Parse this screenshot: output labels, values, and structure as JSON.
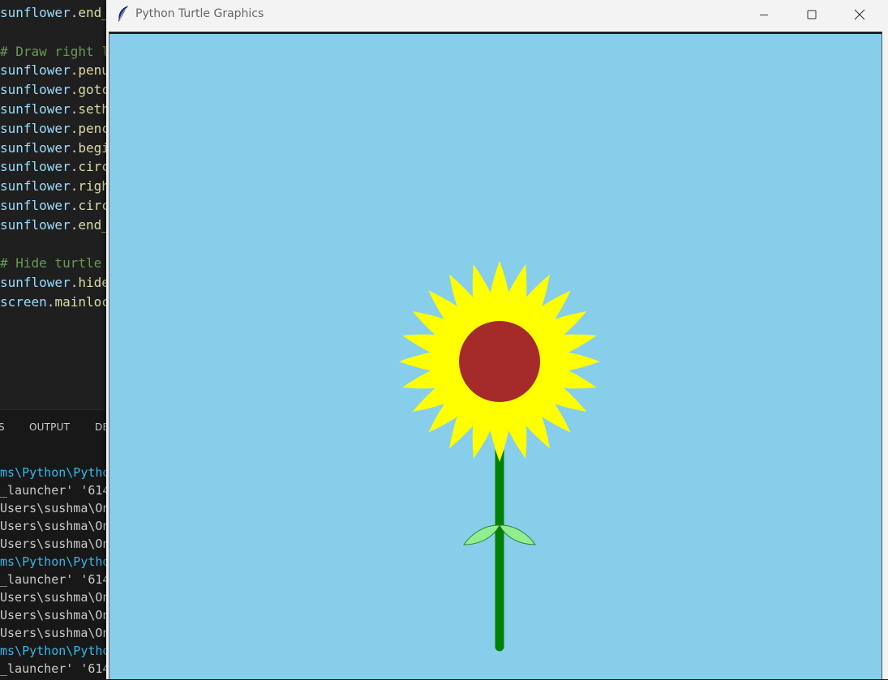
{
  "editor": {
    "lines": [
      {
        "kind": "code",
        "obj": "sunflower",
        "method": "end_"
      },
      {
        "kind": "blank"
      },
      {
        "kind": "comment",
        "text": "# Draw right l"
      },
      {
        "kind": "code",
        "obj": "sunflower",
        "method": "penu"
      },
      {
        "kind": "code",
        "obj": "sunflower",
        "method": "gotc"
      },
      {
        "kind": "code",
        "obj": "sunflower",
        "method": "seth"
      },
      {
        "kind": "code",
        "obj": "sunflower",
        "method": "penc"
      },
      {
        "kind": "code",
        "obj": "sunflower",
        "method": "begi"
      },
      {
        "kind": "code",
        "obj": "sunflower",
        "method": "circ"
      },
      {
        "kind": "code",
        "obj": "sunflower",
        "method": "righ"
      },
      {
        "kind": "code",
        "obj": "sunflower",
        "method": "circ"
      },
      {
        "kind": "code",
        "obj": "sunflower",
        "method": "end_"
      },
      {
        "kind": "blank"
      },
      {
        "kind": "comment",
        "text": "# Hide turtle"
      },
      {
        "kind": "code",
        "obj": "sunflower",
        "method": "hide"
      },
      {
        "kind": "code",
        "obj": "screen",
        "method": "mainloc"
      }
    ]
  },
  "panel": {
    "tabs": [
      "S",
      "OUTPUT",
      "DE"
    ],
    "terminal_lines": [
      {
        "kind": "path",
        "text": "ms\\Python\\Pythor"
      },
      {
        "kind": "plain",
        "text": "_launcher' '614"
      },
      {
        "kind": "plain",
        "text": "Users\\sushma\\One"
      },
      {
        "kind": "plain",
        "text": "Users\\sushma\\One"
      },
      {
        "kind": "plain",
        "text": "Users\\sushma\\One"
      },
      {
        "kind": "path",
        "text": "ms\\Python\\Pythor"
      },
      {
        "kind": "plain",
        "text": "_launcher' '614("
      },
      {
        "kind": "plain",
        "text": "Users\\sushma\\One"
      },
      {
        "kind": "plain",
        "text": "Users\\sushma\\One"
      },
      {
        "kind": "plain",
        "text": "Users\\sushma\\One"
      },
      {
        "kind": "path",
        "text": "ms\\Python\\Pythor"
      },
      {
        "kind": "plain",
        "text": "_launcher' '614"
      }
    ]
  },
  "window": {
    "title": "Python Turtle Graphics",
    "icon": "feather-icon",
    "controls": [
      "minimize-icon",
      "maximize-icon",
      "close-icon"
    ]
  },
  "drawing": {
    "background_color": "#87ceeb",
    "petal_color": "#ffff00",
    "center_color": "#a52a2a",
    "stem_color": "#008000",
    "leaf_color": "#90ee90",
    "petal_count": 24
  }
}
